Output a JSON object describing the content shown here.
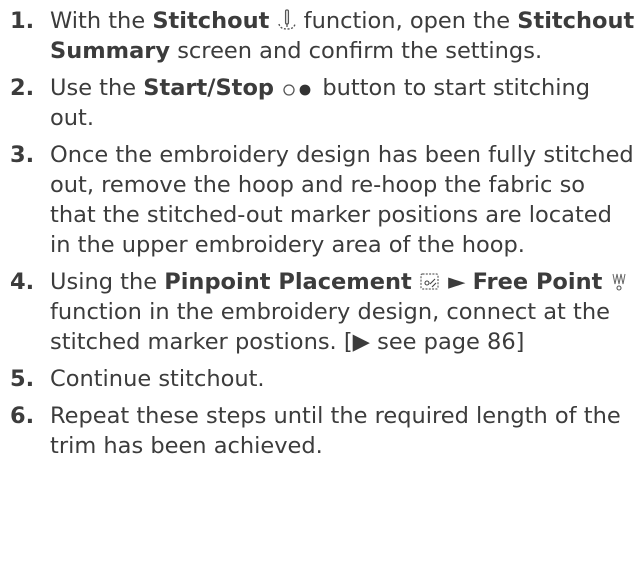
{
  "steps": [
    {
      "number": "1.",
      "part1": "With the ",
      "bold1": "Stitchout",
      "icon1": "stitchout-needle-icon",
      "part2": " function, open the ",
      "bold2": "Stitchout Summary",
      "part3": " screen and confirm the settings."
    },
    {
      "number": "2.",
      "part1": "Use the ",
      "bold1": "Start/Stop",
      "icon1": "start-stop-icon",
      "part2": "  button to start stitching out."
    },
    {
      "number": "3.",
      "text": "Once the embroidery design has been fully stitched out, remove the hoop and re-hoop the fabric so that the stitched-out marker positions are located in the upper embroidery area of the hoop."
    },
    {
      "number": "4.",
      "part1": "Using the ",
      "bold1": "Pinpoint Placement",
      "icon1": "pinpoint-placement-icon",
      "arrow": " ► ",
      "bold2": "Free Point",
      "icon2": "free-point-icon",
      "part2": " function in the embroidery design, connect at the stitched marker postions. [",
      "see_arrow": "▶",
      "part3": " see page 86]"
    },
    {
      "number": "5.",
      "text": "Continue stitchout."
    },
    {
      "number": "6.",
      "text": "Repeat these steps until the required length of the trim has been achieved."
    }
  ]
}
